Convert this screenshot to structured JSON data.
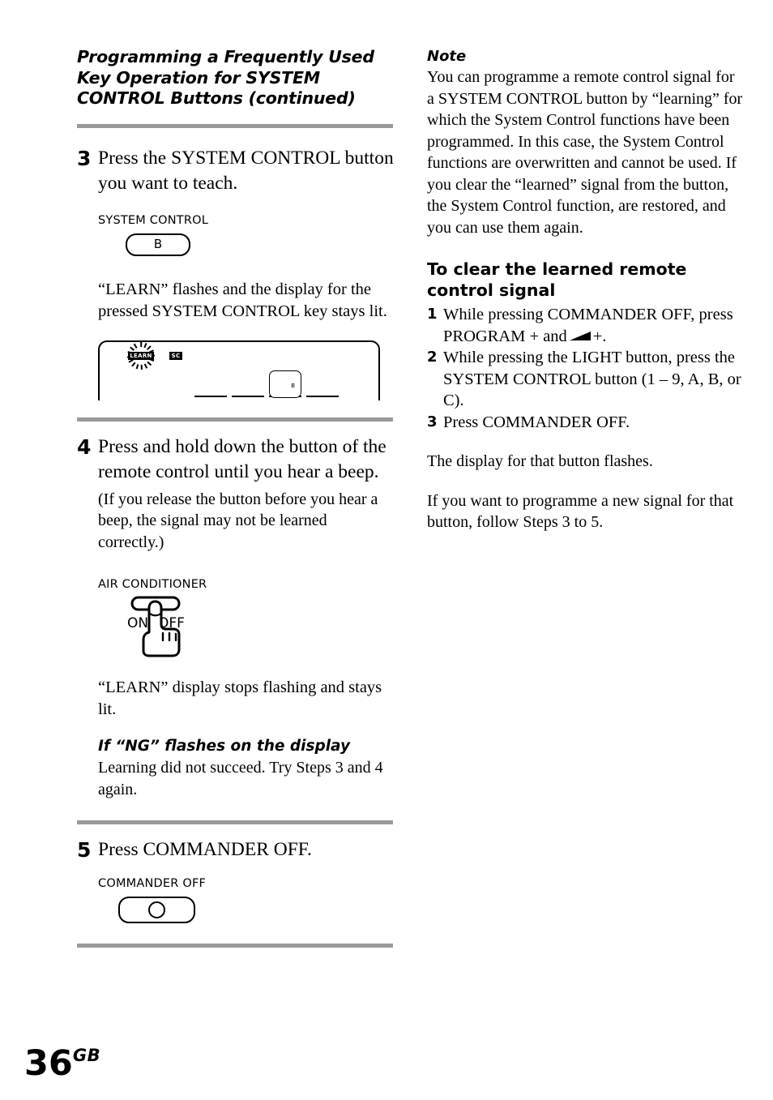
{
  "page": {
    "number": "36",
    "region_suffix": "GB"
  },
  "left_column": {
    "section_title": "Programming a Frequently Used Key Operation for SYSTEM CONTROL Buttons (continued)",
    "steps": [
      {
        "number": "3",
        "heading": "Press the SYSTEM CONTROL button you want to teach.",
        "illustration": {
          "label": "SYSTEM CONTROL",
          "button_cap": "B"
        },
        "body": "“LEARN” flashes and the display for the pressed SYSTEM CONTROL key stays lit.",
        "lcd": {
          "learn_indicator": "LEARN",
          "sc_indicator": "SC",
          "active_key": "B"
        }
      },
      {
        "number": "4",
        "heading": "Press and hold down the button of the remote control until you hear a beep.",
        "body": "(If you release the button before you hear a beep, the signal may not be learned correctly.)",
        "illustration": {
          "label": "AIR CONDITIONER",
          "button_on": "ON",
          "button_off": "OFF"
        },
        "after": "“LEARN” display stops flashing and stays lit.",
        "subhead": "If “NG” flashes on the display",
        "subhead_body": "Learning did not succeed. Try Steps 3 and 4 again."
      },
      {
        "number": "5",
        "heading": "Press COMMANDER OFF.",
        "illustration": {
          "label": "COMMANDER OFF"
        }
      }
    ]
  },
  "right_column": {
    "note_heading": "Note",
    "note_body": "You can programme a remote control signal for a SYSTEM CONTROL button by “learning” for which the System Control functions have been programmed. In this case, the System Control functions are overwritten and cannot be used. If you clear the “learned” signal from the button, the System Control function, are restored, and you can use them again.",
    "clear_heading": "To clear the learned remote control signal",
    "clear_steps": [
      {
        "number": "1",
        "text_before": "While pressing COMMANDER OFF, press PROGRAM + and",
        "text_after": "+."
      },
      {
        "number": "2",
        "text_before": "While pressing the LIGHT button, press the SYSTEM CONTROL button (1 – 9, A, B, or C).",
        "text_after": ""
      },
      {
        "number": "3",
        "text_before": "Press COMMANDER OFF.",
        "text_after": ""
      }
    ],
    "closing_1": "The display for that button flashes.",
    "closing_2": "If you want to programme a new signal for that button, follow Steps 3 to 5."
  }
}
